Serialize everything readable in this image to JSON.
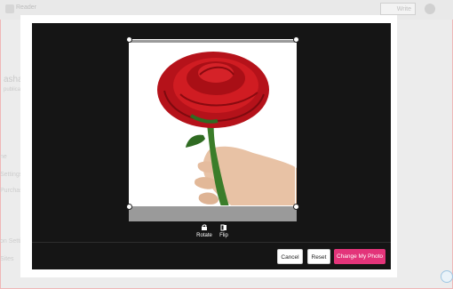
{
  "app": {
    "title": "Reader",
    "write_label": "Write"
  },
  "background": {
    "user_name": "asharap",
    "user_sub": "publication",
    "side_items": [
      "ne",
      "Settings",
      "Purchases",
      "on Settings",
      "Sites"
    ]
  },
  "crop_tools": {
    "rotate_label": "Rotate",
    "flip_label": "Flip"
  },
  "actions": {
    "cancel_label": "Cancel",
    "reset_label": "Reset",
    "change_label": "Change My Photo"
  },
  "colors": {
    "overlay": "#151515",
    "primary": "#e3347a",
    "rose": "#c8161b",
    "stem": "#3b7d2a"
  }
}
